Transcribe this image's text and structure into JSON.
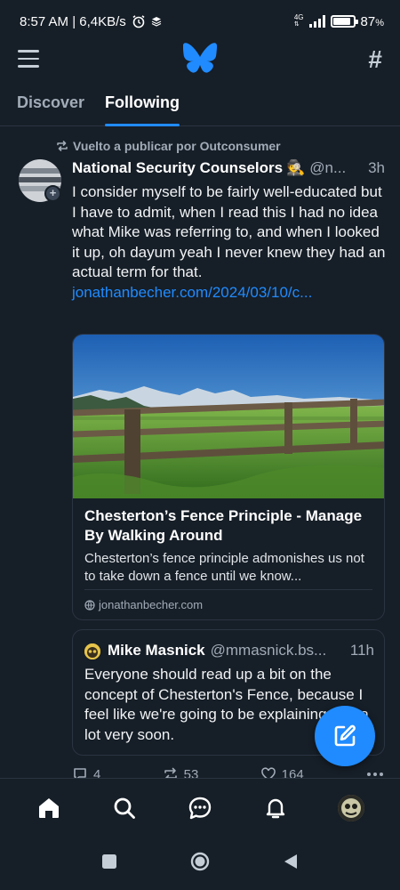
{
  "status_bar": {
    "time_speed": "8:57 AM | 6,4KB/s",
    "network": "4G",
    "battery": "87",
    "battery_level": 0.87
  },
  "header": {
    "menu_icon": "hamburger-icon",
    "logo_icon": "butterfly-icon",
    "feeds_icon": "hash-icon"
  },
  "tabs": [
    {
      "label": "Discover",
      "active": false
    },
    {
      "label": "Following",
      "active": true
    }
  ],
  "post": {
    "repost_label": "Vuelto a publicar por Outconsumer",
    "author_name": "National Security Counselors",
    "author_emoji": "🕵️",
    "author_handle": "@n...",
    "time": "3h",
    "text": "I consider myself to be fairly well-educated but I have to admit, when I read this I had no idea what Mike was referring to, and when I looked it up, oh dayum yeah I never knew they had an actual term for that. ",
    "link": "jonathanbecher.com/2024/03/10/c...",
    "card": {
      "title": "Chesterton’s Fence Principle - Manage By Walking Around",
      "description": "Chesterton’s fence principle admonishes us not to take down a fence until we know...",
      "domain": "jonathanbecher.com"
    },
    "quote": {
      "author_name": "Mike Masnick",
      "author_handle": "@mmasnick.bs...",
      "time": "11h",
      "text": "Everyone should read up a bit on the concept of Chesterton's Fence, because I feel like we're going to be explaining that a lot very soon."
    },
    "actions": {
      "replies": "4",
      "reposts": "53",
      "likes": "164"
    }
  },
  "compose_icon": "compose-icon",
  "bottom_nav": [
    "home-icon",
    "search-icon",
    "chat-icon",
    "bell-icon",
    "profile-avatar"
  ],
  "system_nav": [
    "recents-button",
    "home-button",
    "back-button"
  ],
  "colors": {
    "background": "#161e27",
    "accent": "#208bfe",
    "muted": "#a1acb8",
    "border": "#2a3442"
  }
}
